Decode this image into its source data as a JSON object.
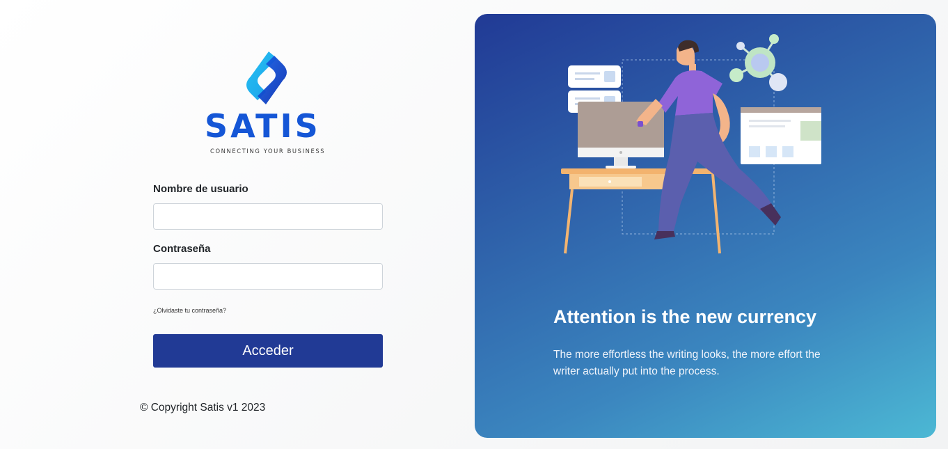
{
  "brand": {
    "name": "SATIS",
    "tagline": "CONNECTING YOUR BUSINESS",
    "color": "#1556d6"
  },
  "form": {
    "username_label": "Nombre de usuario",
    "username_value": "",
    "password_label": "Contraseña",
    "password_value": "",
    "forgot_link": "¿Olvidaste tu contraseña?",
    "submit_label": "Acceder",
    "submit_color": "#213a95"
  },
  "footer": {
    "copyright": "© Copyright Satis v1 2023"
  },
  "hero": {
    "title": "Attention is the new currency",
    "text": "The more effortless the writing looks, the more effort the writer actually put into the process.",
    "gradient_start": "#213a95",
    "gradient_end": "#4cb8d4"
  }
}
